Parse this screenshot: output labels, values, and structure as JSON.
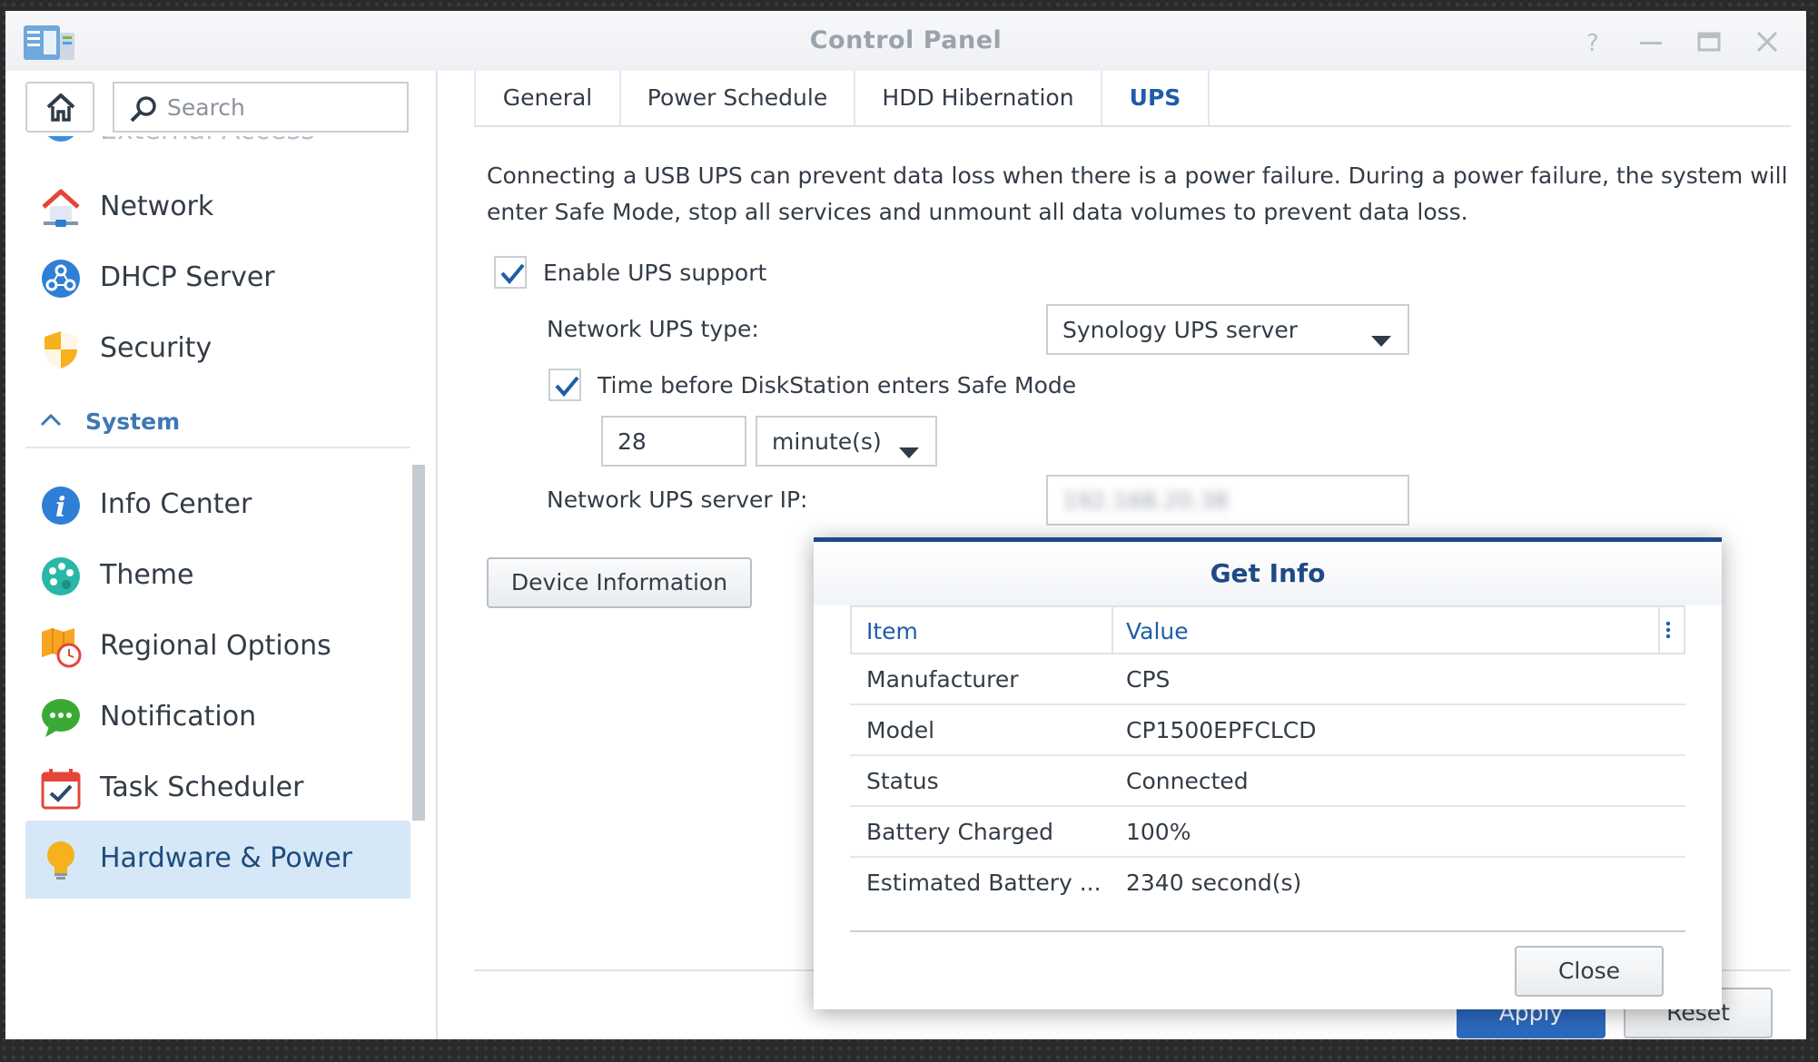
{
  "window": {
    "title": "Control Panel"
  },
  "sidebar": {
    "search_placeholder": "Search",
    "cut_off_item": "External Access",
    "items": [
      {
        "label": "Network",
        "icon": "network-icon"
      },
      {
        "label": "DHCP Server",
        "icon": "dhcp-icon"
      },
      {
        "label": "Security",
        "icon": "shield-icon"
      }
    ],
    "section": "System",
    "system_items": [
      {
        "label": "Info Center",
        "icon": "info-icon"
      },
      {
        "label": "Theme",
        "icon": "palette-icon"
      },
      {
        "label": "Regional Options",
        "icon": "regional-clock-icon"
      },
      {
        "label": "Notification",
        "icon": "chat-bubble-icon"
      },
      {
        "label": "Task Scheduler",
        "icon": "calendar-check-icon"
      },
      {
        "label": "Hardware & Power",
        "icon": "lightbulb-icon",
        "active": true
      }
    ]
  },
  "tabs": [
    "General",
    "Power Schedule",
    "HDD Hibernation",
    "UPS"
  ],
  "active_tab": "UPS",
  "ups": {
    "description": "Connecting a USB UPS can prevent data loss when there is a power failure. During a power failure, the system will enter Safe Mode, stop all services and unmount all data volumes to prevent data loss.",
    "enable_label": "Enable UPS support",
    "enable_checked": true,
    "type_label": "Network UPS type:",
    "type_value": "Synology UPS server",
    "safe_mode_label": "Time before DiskStation enters Safe Mode",
    "safe_mode_checked": true,
    "time_value": "28",
    "time_unit": "minute(s)",
    "server_ip_label": "Network UPS server IP:",
    "server_ip_value": "192.168.20.38",
    "device_info_button": "Device Information"
  },
  "footer": {
    "apply": "Apply",
    "reset": "Reset"
  },
  "dialog": {
    "title": "Get Info",
    "columns": [
      "Item",
      "Value"
    ],
    "rows": [
      {
        "item": "Manufacturer",
        "value": "CPS"
      },
      {
        "item": "Model",
        "value": "CP1500EPFCLCD"
      },
      {
        "item": "Status",
        "value": "Connected"
      },
      {
        "item": "Battery Charged",
        "value": "100%"
      },
      {
        "item": "Estimated Battery ...",
        "value": "2340 second(s)"
      }
    ],
    "close": "Close"
  },
  "colors": {
    "accent": "#1e4a86",
    "active_sidebar": "#d6e7f8",
    "apply_button": "#2c6ac0"
  }
}
